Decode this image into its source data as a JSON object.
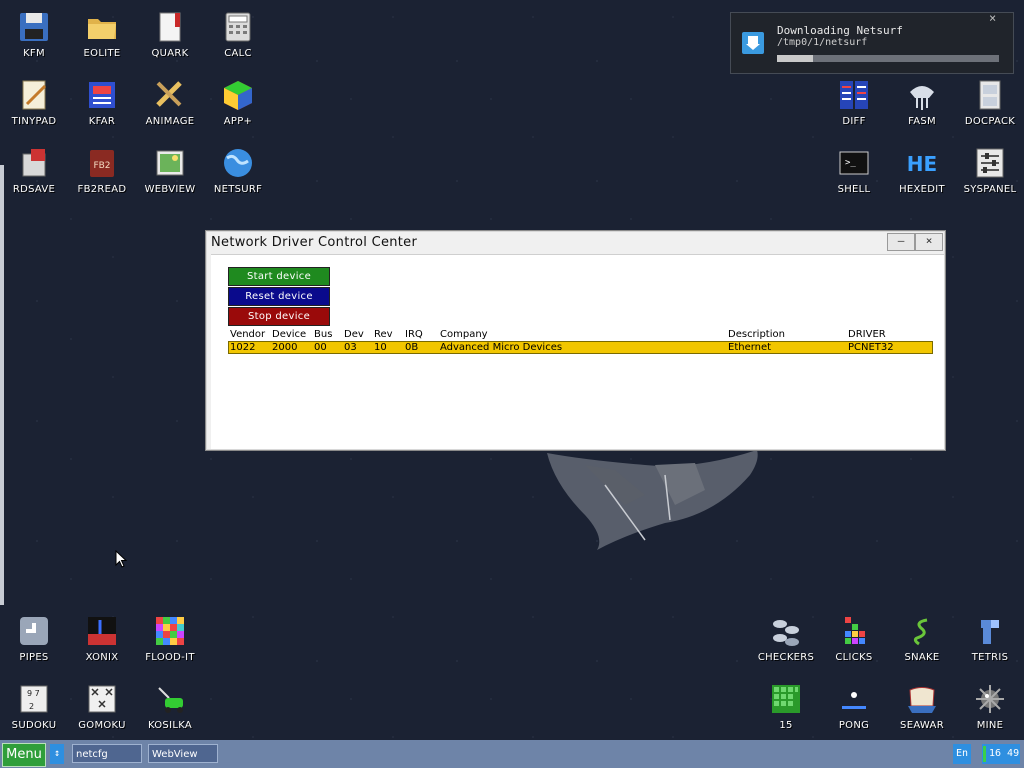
{
  "desktop": {
    "icons": [
      {
        "label": "KFM",
        "icon": "floppy-disk-icon"
      },
      {
        "label": "EOLITE",
        "icon": "folder-icon"
      },
      {
        "label": "QUARK",
        "icon": "book-icon"
      },
      {
        "label": "CALC",
        "icon": "calculator-icon"
      },
      {
        "label": "TINYPAD",
        "icon": "notepad-icon"
      },
      {
        "label": "KFAR",
        "icon": "archive-icon"
      },
      {
        "label": "ANIMAGE",
        "icon": "pencil-ruler-icon"
      },
      {
        "label": "APP+",
        "icon": "cube-icon"
      },
      {
        "label": "RDSAVE",
        "icon": "ramdisk-icon"
      },
      {
        "label": "FB2READ",
        "icon": "fb2-book-icon"
      },
      {
        "label": "WEBVIEW",
        "icon": "image-icon"
      },
      {
        "label": "NETSURF",
        "icon": "globe-icon"
      },
      {
        "label": "DIFF",
        "icon": "diff-icon"
      },
      {
        "label": "FASM",
        "icon": "fasm-icon"
      },
      {
        "label": "DOCPACK",
        "icon": "cabinet-icon"
      },
      {
        "label": "SHELL",
        "icon": "terminal-icon"
      },
      {
        "label": "HEXEDIT",
        "icon": "hex-icon"
      },
      {
        "label": "SYSPANEL",
        "icon": "sliders-icon"
      },
      {
        "label": "PIPES",
        "icon": "pipes-icon"
      },
      {
        "label": "XONIX",
        "icon": "xonix-icon"
      },
      {
        "label": "FLOOD-IT",
        "icon": "flood-grid-icon"
      },
      {
        "label": "CHECKERS",
        "icon": "checkers-icon"
      },
      {
        "label": "CLICKS",
        "icon": "clicks-icon"
      },
      {
        "label": "SNAKE",
        "icon": "snake-icon"
      },
      {
        "label": "TETRIS",
        "icon": "tetris-icon"
      },
      {
        "label": "SUDOKU",
        "icon": "sudoku-icon"
      },
      {
        "label": "GOMOKU",
        "icon": "gomoku-icon"
      },
      {
        "label": "KOSILKA",
        "icon": "lawnmower-icon"
      },
      {
        "label": "15",
        "icon": "fifteen-icon"
      },
      {
        "label": "PONG",
        "icon": "pong-icon"
      },
      {
        "label": "SEAWAR",
        "icon": "ship-icon"
      },
      {
        "label": "MINE",
        "icon": "mine-icon"
      }
    ]
  },
  "notification": {
    "title": "Downloading Netsurf",
    "path": "/tmp0/1/netsurf",
    "progress": 0.16,
    "close_label": "×"
  },
  "window": {
    "title": "Network Driver Control Center",
    "minimize_label": "—",
    "close_label": "×",
    "buttons": {
      "start": "Start device",
      "reset": "Reset device",
      "stop": "Stop device"
    },
    "columns": [
      "Vendor",
      "Device",
      "Bus",
      "Dev",
      "Rev",
      "IRQ",
      "Company",
      "Description",
      "DRIVER"
    ],
    "rows": [
      [
        "1022",
        "2000",
        "00",
        "03",
        "10",
        "0B",
        "Advanced Micro Devices",
        "Ethernet",
        "PCNET32"
      ]
    ]
  },
  "taskbar": {
    "menu_label": "Menu",
    "switch_label": "↕",
    "tasks": [
      "netcfg",
      "WebView"
    ],
    "lang": "En",
    "clock": "16 49"
  },
  "colors": {
    "desktop_bg": "#1b2233",
    "start_button": "#1f8a1f",
    "reset_button": "#0a0a8c",
    "stop_button": "#9a0a0a",
    "selected_row": "#f2c600",
    "taskbar": "#6e84a8"
  }
}
